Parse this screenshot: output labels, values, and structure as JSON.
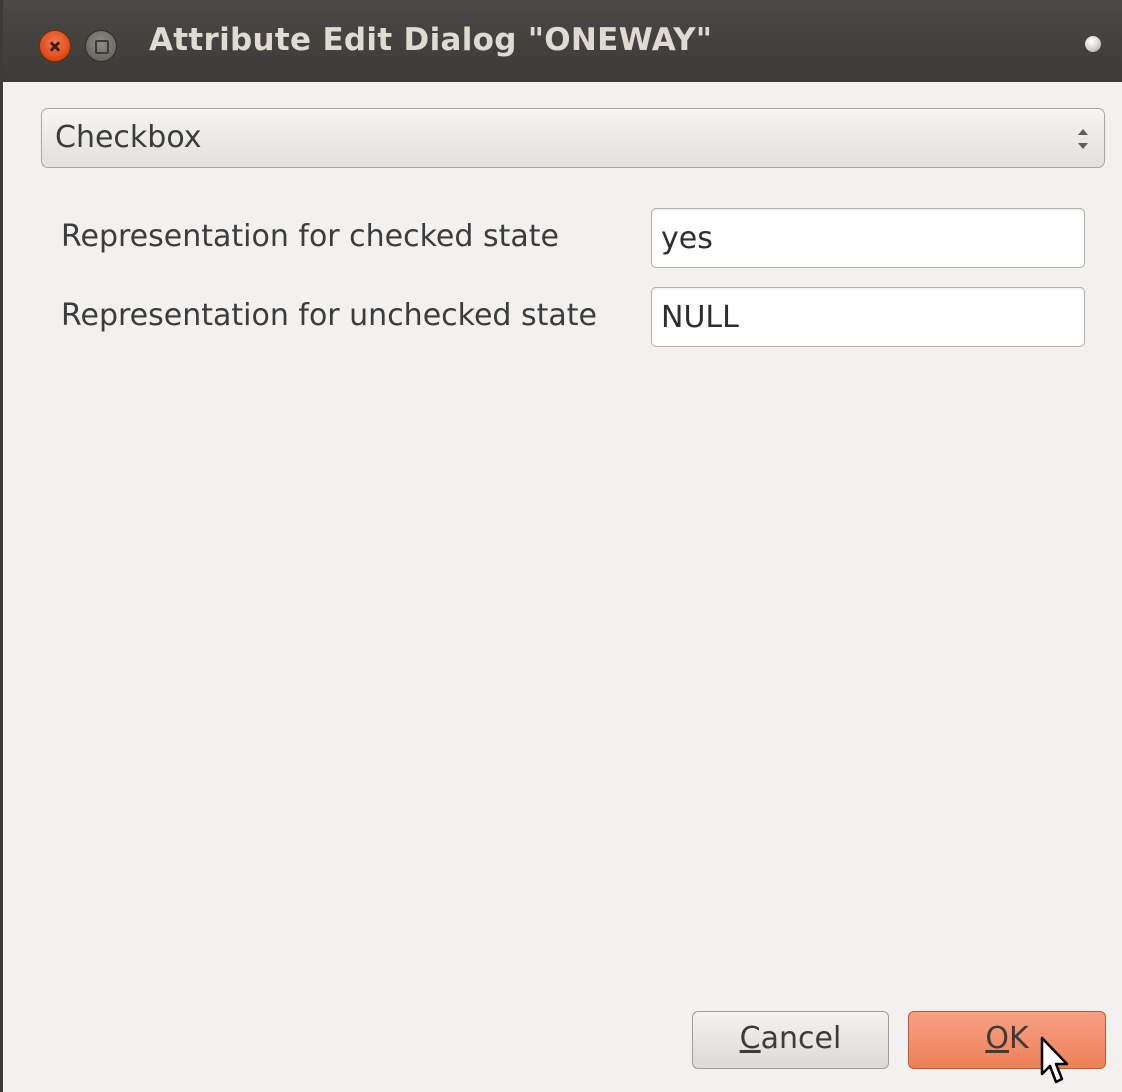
{
  "window": {
    "title": "Attribute Edit Dialog \"ONEWAY\""
  },
  "widget_type": {
    "selected": "Checkbox"
  },
  "form": {
    "checked_label": "Representation for checked state",
    "checked_value": "yes",
    "unchecked_label": "Representation for unchecked state",
    "unchecked_value": "NULL"
  },
  "buttons": {
    "cancel_mnemonic": "C",
    "cancel_rest": "ancel",
    "ok_mnemonic": "O",
    "ok_rest": "K"
  },
  "icons": {
    "close": "close-icon",
    "maximize": "maximize-icon",
    "menu_dot": "window-menu-icon",
    "combo_arrows": "up-down-arrows-icon",
    "cursor": "mouse-pointer-icon"
  },
  "colors": {
    "titlebar": "#3c3b37",
    "title_text": "#dfdbd2",
    "close_button": "#dd4814",
    "ok_button": "#ec8058",
    "background": "#f2f1f0"
  }
}
